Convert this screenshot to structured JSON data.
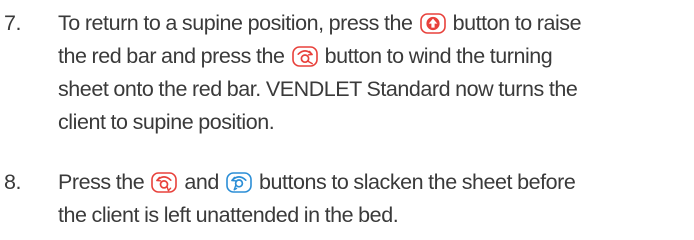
{
  "steps": [
    {
      "number": "7.",
      "l1_a": "To return to a supine position, press the",
      "l1_b": "button to raise",
      "l2_a": "the red bar and press the",
      "l2_b": "button to wind the turning",
      "l3": "sheet onto the red bar. VENDLET Standard now turns the",
      "l4": "client to supine position.",
      "icons": [
        "raise-arrow-icon",
        "wind-sheet-icon"
      ]
    },
    {
      "number": "8.",
      "l1_a": "Press the",
      "l1_b": "and",
      "l1_c": "buttons to slacken the sheet before",
      "l2": "the client is left unattended in the bed.",
      "icons": [
        "slacken-left-icon",
        "slacken-right-icon"
      ]
    }
  ],
  "colors": {
    "text": "#3a3a3a",
    "red_button": "#e8413b",
    "blue_button": "#2b8ed6"
  }
}
